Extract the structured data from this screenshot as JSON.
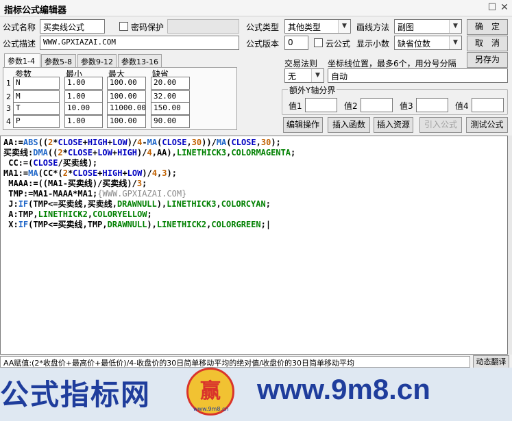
{
  "window": {
    "title": "指标公式编辑器",
    "maximize_glyph": "☐",
    "close_glyph": "✕"
  },
  "form": {
    "name_label": "公式名称",
    "name_value": "买卖线公式",
    "password_label": "密码保护",
    "password_value": "",
    "desc_label": "公式描述",
    "desc_value": "WWW.GPXIAZAI.COM",
    "type_label": "公式类型",
    "type_value": "其他类型",
    "draw_label": "画线方法",
    "draw_value": "副图",
    "version_label": "公式版本",
    "version_value": "0",
    "cloud_label": "云公式",
    "decimals_label": "显示小数",
    "decimals_value": "缺省位数"
  },
  "buttons": {
    "ok": "确　定",
    "cancel": "取　消",
    "save_as": "另存为",
    "edit_op": "编辑操作",
    "insert_func": "插入函数",
    "insert_res": "插入资源",
    "import": "引入公式",
    "test": "测试公式",
    "dynamic_translate": "动态翻译"
  },
  "tabs": [
    "参数1-4",
    "参数5-8",
    "参数9-12",
    "参数13-16"
  ],
  "params": {
    "headers": [
      "参数",
      "最小",
      "最大",
      "缺省"
    ],
    "rows": [
      {
        "idx": "1",
        "name": "N",
        "min": "1.00",
        "max": "100.00",
        "def": "20.00"
      },
      {
        "idx": "2",
        "name": "M",
        "min": "1.00",
        "max": "100.00",
        "def": "32.00"
      },
      {
        "idx": "3",
        "name": "T",
        "min": "10.00",
        "max": "11000.00",
        "def": "150.00"
      },
      {
        "idx": "4",
        "name": "P",
        "min": "1.00",
        "max": "100.00",
        "def": "90.00"
      }
    ]
  },
  "trade": {
    "rule_label": "交易法则",
    "rule_value": "无",
    "coord_label": "坐标线位置，最多6个，用分号分隔",
    "coord_value": "自动"
  },
  "yaxis": {
    "title": "额外Y轴分界",
    "labels": [
      "值1",
      "值2",
      "值3",
      "值4"
    ],
    "values": [
      "",
      "",
      "",
      ""
    ]
  },
  "code": [
    [
      [
        "d",
        "AA:="
      ],
      [
        "f",
        "ABS"
      ],
      [
        "d",
        "(("
      ],
      [
        "n",
        "2"
      ],
      [
        "d",
        "*"
      ],
      [
        "v",
        "CLOSE"
      ],
      [
        "d",
        "+"
      ],
      [
        "v",
        "HIGH"
      ],
      [
        "d",
        "+"
      ],
      [
        "v",
        "LOW"
      ],
      [
        "d",
        ")/"
      ],
      [
        "n",
        "4"
      ],
      [
        "d",
        "-"
      ],
      [
        "f",
        "MA"
      ],
      [
        "d",
        "("
      ],
      [
        "v",
        "CLOSE"
      ],
      [
        "d",
        ","
      ],
      [
        "n",
        "30"
      ],
      [
        "d",
        "))/"
      ],
      [
        "f",
        "MA"
      ],
      [
        "d",
        "("
      ],
      [
        "v",
        "CLOSE"
      ],
      [
        "d",
        ","
      ],
      [
        "n",
        "30"
      ],
      [
        "d",
        ");"
      ]
    ],
    [
      [
        "d",
        "买卖线:"
      ],
      [
        "f",
        "DMA"
      ],
      [
        "d",
        "(("
      ],
      [
        "n",
        "2"
      ],
      [
        "d",
        "*"
      ],
      [
        "v",
        "CLOSE"
      ],
      [
        "d",
        "+"
      ],
      [
        "v",
        "LOW"
      ],
      [
        "d",
        "+"
      ],
      [
        "v",
        "HIGH"
      ],
      [
        "d",
        ")/"
      ],
      [
        "n",
        "4"
      ],
      [
        "d",
        ",AA),"
      ],
      [
        "c",
        "LINETHICK3"
      ],
      [
        "d",
        ","
      ],
      [
        "c",
        "COLORMAGENTA"
      ],
      [
        "d",
        ";"
      ]
    ],
    [
      [
        "d",
        " CC:=("
      ],
      [
        "v",
        "CLOSE"
      ],
      [
        "d",
        "/买卖线);"
      ]
    ],
    [
      [
        "d",
        "MA1:="
      ],
      [
        "f",
        "MA"
      ],
      [
        "d",
        "(CC*("
      ],
      [
        "n",
        "2"
      ],
      [
        "d",
        "*"
      ],
      [
        "v",
        "CLOSE"
      ],
      [
        "d",
        "+"
      ],
      [
        "v",
        "HIGH"
      ],
      [
        "d",
        "+"
      ],
      [
        "v",
        "LOW"
      ],
      [
        "d",
        ")/"
      ],
      [
        "n",
        "4"
      ],
      [
        "d",
        ","
      ],
      [
        "n",
        "3"
      ],
      [
        "d",
        ");"
      ]
    ],
    [
      [
        "d",
        " MAAA:=((MA1-买卖线)/买卖线)/"
      ],
      [
        "n",
        "3"
      ],
      [
        "d",
        ";"
      ]
    ],
    [
      [
        "d",
        " TMP:=MA1-MAAA*MA1;"
      ],
      [
        "m",
        "{WWW.GPXIAZAI.COM}"
      ]
    ],
    [
      [
        "d",
        " J:"
      ],
      [
        "f",
        "IF"
      ],
      [
        "d",
        "(TMP<=买卖线,买卖线,"
      ],
      [
        "c",
        "DRAWNULL"
      ],
      [
        "d",
        "),"
      ],
      [
        "c",
        "LINETHICK3"
      ],
      [
        "d",
        ","
      ],
      [
        "c",
        "COLORCYAN"
      ],
      [
        "d",
        ";"
      ]
    ],
    [
      [
        "d",
        " A:TMP,"
      ],
      [
        "c",
        "LINETHICK2"
      ],
      [
        "d",
        ","
      ],
      [
        "c",
        "COLORYELLOW"
      ],
      [
        "d",
        ";"
      ]
    ],
    [
      [
        "d",
        " X:"
      ],
      [
        "f",
        "IF"
      ],
      [
        "d",
        "(TMP<=买卖线,TMP,"
      ],
      [
        "c",
        "DRAWNULL"
      ],
      [
        "d",
        "),"
      ],
      [
        "c",
        "LINETHICK2"
      ],
      [
        "d",
        ","
      ],
      [
        "c",
        "COLORGREEN"
      ],
      [
        "d",
        ";|"
      ]
    ]
  ],
  "status_text": "AA赋值:(2*收盘价+最高价+最低价)/4-收盘价的30日简单移动平均的绝对值/收盘价的30日简单移动平均",
  "watermark": {
    "left": "公式指标网",
    "logo_char": "赢",
    "logo_sub": "www.9m8.cn",
    "right": "www.9m8.cn"
  }
}
